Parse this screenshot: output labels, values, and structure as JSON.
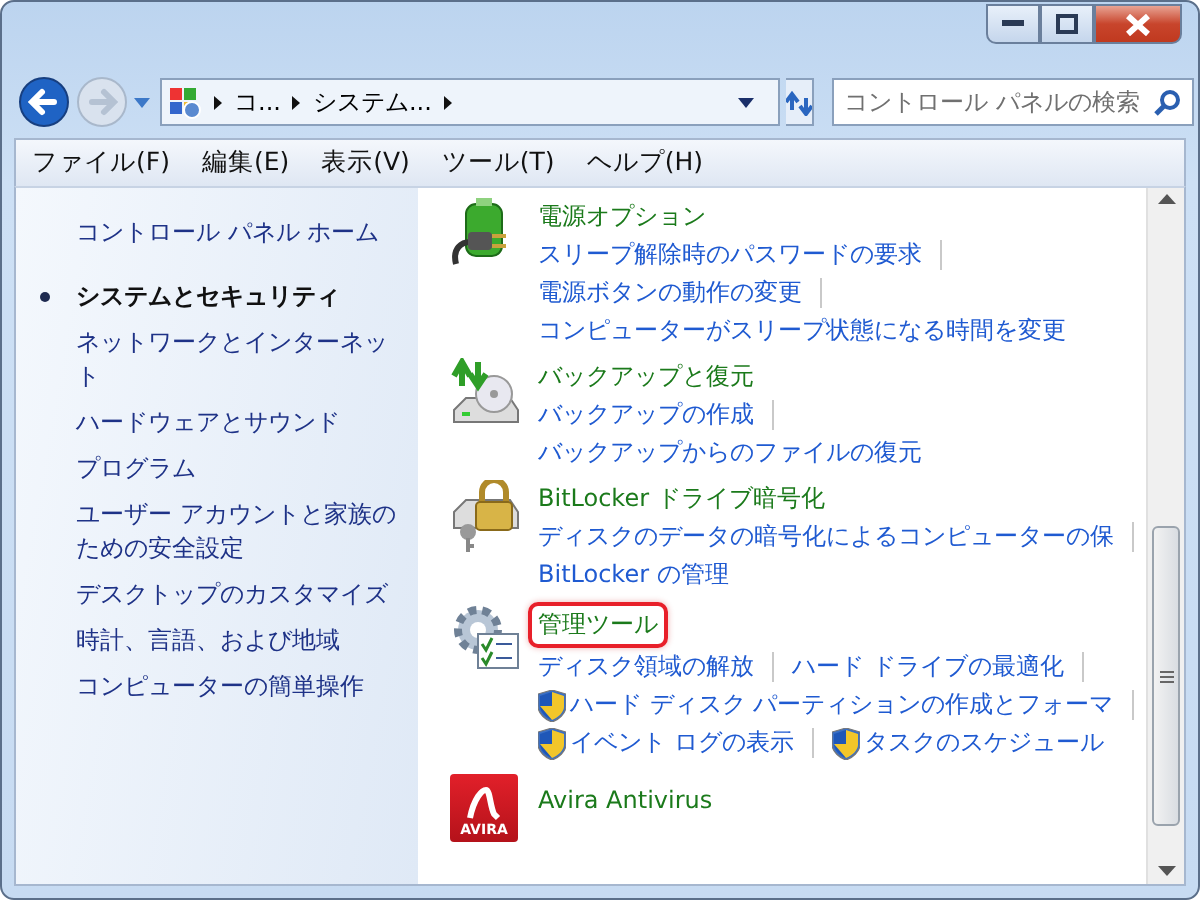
{
  "navigation": {
    "back": {
      "disabled": false
    },
    "forward": {
      "disabled": true
    }
  },
  "address_bar": {
    "crumbs": [
      "コ...",
      "システム..."
    ]
  },
  "search": {
    "placeholder": "コントロール パネルの検索"
  },
  "menu": [
    "ファイル(F)",
    "編集(E)",
    "表示(V)",
    "ツール(T)",
    "ヘルプ(H)"
  ],
  "sidebar": {
    "home": "コントロール パネル ホーム",
    "items": [
      {
        "label": "システムとセキュリティ",
        "selected": true
      },
      {
        "label": "ネットワークとインターネット",
        "selected": false
      },
      {
        "label": "ハードウェアとサウンド",
        "selected": false
      },
      {
        "label": "プログラム",
        "selected": false
      },
      {
        "label": "ユーザー アカウントと家族のための安全設定",
        "selected": false
      },
      {
        "label": "デスクトップのカスタマイズ",
        "selected": false
      },
      {
        "label": "時計、言語、および地域",
        "selected": false
      },
      {
        "label": "コンピューターの簡単操作",
        "selected": false
      }
    ]
  },
  "sections": [
    {
      "kind": "power",
      "title": "電源オプション",
      "highlighted": false,
      "links": [
        {
          "label": "スリープ解除時のパスワードの要求",
          "uac": false
        },
        {
          "label": "電源ボタンの動作の変更",
          "uac": false
        },
        {
          "label": "コンピューターがスリープ状態になる時間を変更",
          "uac": false
        }
      ]
    },
    {
      "kind": "backup",
      "title": "バックアップと復元",
      "highlighted": false,
      "links": [
        {
          "label": "バックアップの作成",
          "uac": false
        },
        {
          "label": "バックアップからのファイルの復元",
          "uac": false
        }
      ]
    },
    {
      "kind": "bitlocker",
      "title": "BitLocker ドライブ暗号化",
      "highlighted": false,
      "links": [
        {
          "label": "ディスクのデータの暗号化によるコンピューターの保",
          "uac": false
        },
        {
          "label": "BitLocker の管理",
          "uac": false
        }
      ]
    },
    {
      "kind": "admin",
      "title": "管理ツール",
      "highlighted": true,
      "links": [
        {
          "label": "ディスク領域の解放",
          "uac": false
        },
        {
          "label": "ハード ドライブの最適化",
          "uac": false
        },
        {
          "label": "ハード ディスク パーティションの作成とフォーマ",
          "uac": true
        },
        {
          "label": "イベント ログの表示",
          "uac": true
        },
        {
          "label": "タスクのスケジュール",
          "uac": true
        }
      ]
    },
    {
      "kind": "avira",
      "title": "Avira Antivirus",
      "highlighted": false,
      "logo_text": "AVIRA"
    }
  ]
}
